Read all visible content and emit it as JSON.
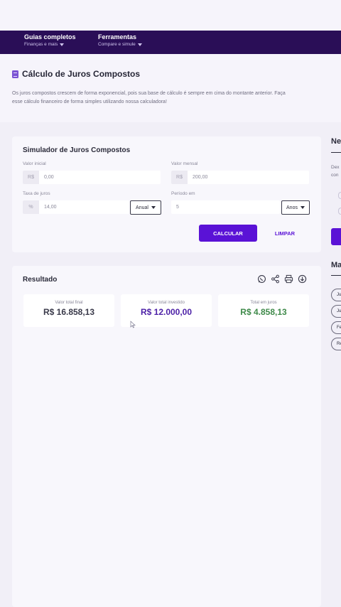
{
  "nav": {
    "items": [
      {
        "title": "Guias completos",
        "subtitle": "Finanças e mais"
      },
      {
        "title": "Ferramentas",
        "subtitle": "Compare e simule"
      }
    ]
  },
  "intro": {
    "title": "Cálculo de Juros Compostos",
    "text": "Os juros compostos crescem de forma exponencial, pois sua base de cálculo é sempre em cima do montante anterior. Faça esse cálculo financeiro de forma simples utilizando nossa calculadora!"
  },
  "simulator": {
    "title": "Simulador de Juros Compostos",
    "valor_inicial": {
      "label": "Valor inicial",
      "prefix": "R$",
      "value": "0,00"
    },
    "valor_mensal": {
      "label": "Valor mensal",
      "prefix": "R$",
      "value": "200,00"
    },
    "taxa": {
      "label": "Taxa de juros",
      "prefix": "%",
      "value": "14,00",
      "unit": "Anual"
    },
    "periodo": {
      "label": "Período em",
      "value": "5",
      "unit": "Anos"
    },
    "calc_label": "CALCULAR",
    "clear_label": "LIMPAR"
  },
  "result": {
    "title": "Resultado",
    "boxes": [
      {
        "label": "Valor total final",
        "value": "R$ 16.858,13",
        "color": "#3a3a4a"
      },
      {
        "label": "Valor total investido",
        "value": "R$ 12.000,00",
        "color": "#4b1fa6"
      },
      {
        "label": "Total em juros",
        "value": "R$ 4.858,13",
        "color": "#3f8a4a"
      }
    ]
  },
  "sidebar": {
    "heading1": "Ne",
    "text1a": "Dex",
    "text1b": "con",
    "heading2": "Ma",
    "pills": [
      "Ju",
      "Ju",
      "Fe",
      "Re"
    ]
  },
  "colors": {
    "primary": "#5a12d6",
    "navbar": "#2a0e57"
  }
}
